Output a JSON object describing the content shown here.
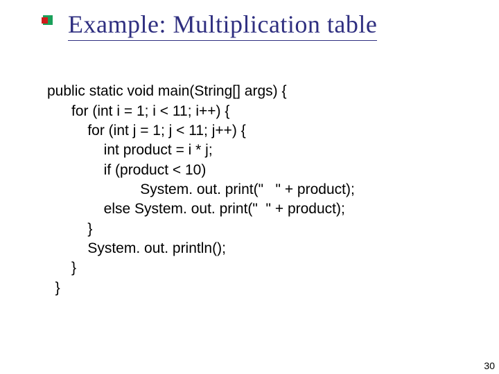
{
  "slide": {
    "title": "Example: Multiplication table",
    "page_number": "30"
  },
  "code": {
    "l1": "public static void main(String[] args) {",
    "l2": "      for (int i = 1; i < 11; i++) {",
    "l3": "          for (int j = 1; j < 11; j++) {",
    "l4": "              int product = i * j;",
    "l5": "              if (product < 10)",
    "l6": "                       System. out. print(\"   \" + product);",
    "l7": "              else System. out. print(\"  \" + product);",
    "l8": "          }",
    "l9": "          System. out. println();",
    "l10": "      }",
    "l11": "  }"
  }
}
